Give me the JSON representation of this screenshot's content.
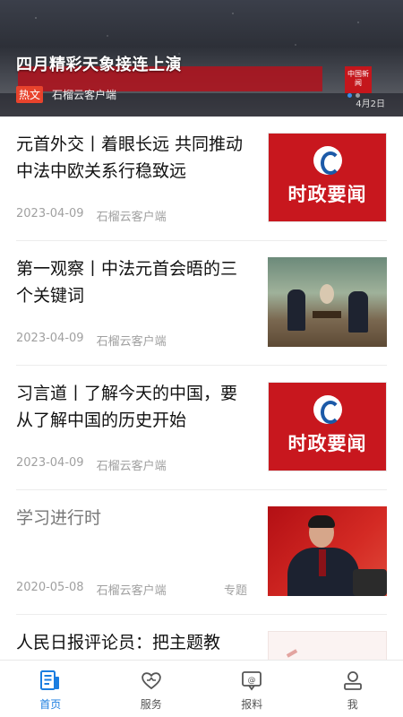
{
  "hero": {
    "title": "四月精彩天象接连上演",
    "tag": "热文",
    "source": "石榴云客户端",
    "video_logo": "中国新闻",
    "video_date": "4月2日"
  },
  "articles": [
    {
      "title": "元首外交丨着眼长远 共同推动中法中欧关系行稳致远",
      "date": "2023-04-09",
      "source": "石榴云客户端",
      "thumb_text": "时政要闻"
    },
    {
      "title": "第一观察丨中法元首会晤的三个关键词",
      "date": "2023-04-09",
      "source": "石榴云客户端"
    },
    {
      "title": "习言道丨了解今天的中国，要从了解中国的历史开始",
      "date": "2023-04-09",
      "source": "石榴云客户端",
      "thumb_text": "时政要闻"
    },
    {
      "title": "学习进行时",
      "date": "2020-05-08",
      "source": "石榴云客户端",
      "badge": "专题"
    },
    {
      "title": "人民日报评论员：把主题教"
    }
  ],
  "nav": [
    {
      "label": "首页",
      "icon": "home-news-icon",
      "active": true
    },
    {
      "label": "服务",
      "icon": "heart-service-icon",
      "active": false
    },
    {
      "label": "报料",
      "icon": "report-chat-icon",
      "active": false
    },
    {
      "label": "我",
      "icon": "user-icon",
      "active": false
    }
  ],
  "colors": {
    "accent": "#1a7de0",
    "hot_tag": "#e8432c",
    "brand_red": "#c8171e"
  }
}
